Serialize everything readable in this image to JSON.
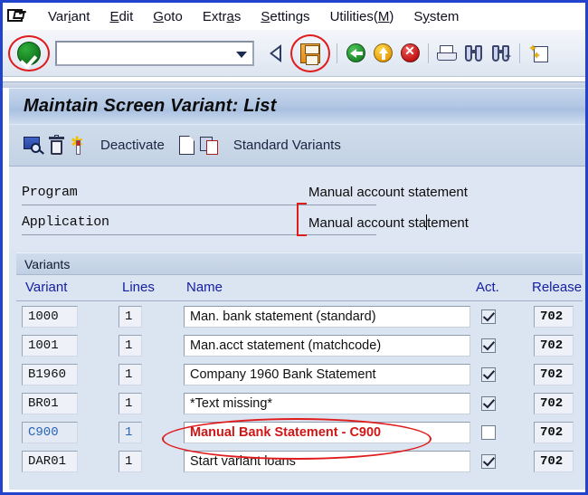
{
  "window": {
    "frame_color": "#2244cc",
    "title": "Maintain Screen Variant: List"
  },
  "menubar": {
    "logo_icon": "sap-menu-logo-icon",
    "items": [
      {
        "pre": "Var",
        "key": "i",
        "post": "ant"
      },
      {
        "pre": "",
        "key": "E",
        "post": "dit"
      },
      {
        "pre": "",
        "key": "G",
        "post": "oto"
      },
      {
        "pre": "Extr",
        "key": "a",
        "post": "s"
      },
      {
        "pre": "",
        "key": "S",
        "post": "ettings"
      },
      {
        "pre": "Utilities(",
        "key": "M",
        "post": ")"
      },
      {
        "pre": "S",
        "key": "y",
        "post": "stem"
      }
    ]
  },
  "system_toolbar": {
    "enter_button_label": "enter-check-icon",
    "command_field": {
      "value": "",
      "placeholder": ""
    },
    "dropdown_icon": "chevron-down-icon",
    "buttons": [
      {
        "name": "back-nav-button",
        "icon": "left-triangle-icon"
      },
      {
        "name": "save-button",
        "icon": "floppy-disk-icon"
      },
      {
        "name": "back-button",
        "icon": "green-left-arrow-icon"
      },
      {
        "name": "exit-button",
        "icon": "yellow-up-arrow-icon"
      },
      {
        "name": "cancel-button",
        "icon": "red-x-icon"
      },
      {
        "name": "print-button",
        "icon": "printer-icon"
      },
      {
        "name": "find-button",
        "icon": "binoculars-icon"
      },
      {
        "name": "find-next-button",
        "icon": "binoculars-plus-icon"
      },
      {
        "name": "create-session-button",
        "icon": "new-session-icon"
      }
    ],
    "annotations": [
      {
        "name": "enter-button-highlight",
        "shape": "circle",
        "color": "#e01b1b"
      },
      {
        "name": "save-button-highlight",
        "shape": "circle",
        "color": "#e01b1b"
      }
    ]
  },
  "app_toolbar": {
    "items": [
      {
        "name": "display-variant-button",
        "icon": "display-magnifier-icon",
        "label": ""
      },
      {
        "name": "delete-variant-button",
        "icon": "trash-icon",
        "label": ""
      },
      {
        "name": "create-variant-button",
        "icon": "magic-wand-icon",
        "label": ""
      },
      {
        "name": "deactivate-button",
        "icon": "",
        "label": "Deactivate"
      },
      {
        "name": "new-variant-button",
        "icon": "page-icon",
        "label": ""
      },
      {
        "name": "copy-variant-button",
        "icon": "copy-icon",
        "label": ""
      },
      {
        "name": "standard-variants-button",
        "icon": "",
        "label": "Standard Variants"
      }
    ],
    "deactivate_label": "Deactivate",
    "standard_variants_label": "Standard Variants"
  },
  "form": {
    "program": {
      "label": "Program",
      "value": "Manual account statement"
    },
    "application": {
      "label": "Application",
      "value_before_caret": "Manual account sta",
      "value_after_caret": "tement"
    },
    "annotation": {
      "name": "application-field-bracket",
      "shape": "bracket",
      "color": "#e01b1b"
    }
  },
  "table": {
    "group_title": "Variants",
    "columns": {
      "variant": "Variant",
      "lines": "Lines",
      "name": "Name",
      "act": "Act.",
      "release": "Release"
    },
    "rows": [
      {
        "variant": "1000",
        "lines": "1",
        "name": "Man. bank statement (standard)",
        "active": true,
        "release": "702",
        "selected": false
      },
      {
        "variant": "1001",
        "lines": "1",
        "name": "Man.acct statement (matchcode)",
        "active": true,
        "release": "702",
        "selected": false
      },
      {
        "variant": "B1960",
        "lines": "1",
        "name": "Company 1960 Bank Statement",
        "active": true,
        "release": "702",
        "selected": false
      },
      {
        "variant": "BR01",
        "lines": "1",
        "name": "*Text missing*",
        "active": true,
        "release": "702",
        "selected": false
      },
      {
        "variant": "C900",
        "lines": "1",
        "name": "Manual Bank Statement - C900",
        "active": false,
        "release": "702",
        "selected": true
      },
      {
        "variant": "DAR01",
        "lines": "1",
        "name": "Start variant loans",
        "active": true,
        "release": "702",
        "selected": false
      }
    ],
    "annotation": {
      "name": "c900-row-highlight",
      "shape": "ellipse",
      "color": "#e01b1b"
    }
  },
  "colors": {
    "frame_blue": "#2244cc",
    "header_text_blue": "#1620a0",
    "selected_row_red": "#d01616",
    "selected_variant_blue": "#2a63b8",
    "annotation_red": "#e01b1b"
  }
}
